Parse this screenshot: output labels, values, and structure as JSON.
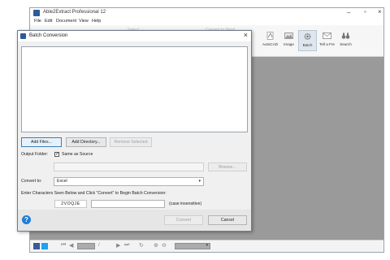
{
  "app": {
    "title": "Able2Extract Professional 12",
    "menu": [
      "File",
      "Edit",
      "Document",
      "View",
      "Help"
    ],
    "ribbon": {
      "ghost_labels": [
        "Select",
        "Convert to Word"
      ],
      "buttons": [
        {
          "label": "AutoCAD",
          "icon": "autocad-icon"
        },
        {
          "label": "Image",
          "icon": "image-icon"
        },
        {
          "label": "Batch",
          "icon": "batch-gear-icon"
        },
        {
          "label": "Tell a Fre",
          "icon": "envelope-icon"
        },
        {
          "label": "Search",
          "icon": "binoculars-icon"
        }
      ],
      "partial_label": "L"
    },
    "statusbar": {
      "page_separator": "/",
      "icons": [
        "facebook-icon",
        "twitter-icon",
        "first-page-icon",
        "prev-page-icon",
        "next-page-icon",
        "last-page-icon",
        "rotate-icon",
        "zoom-in-icon",
        "zoom-out-icon"
      ]
    }
  },
  "dialog": {
    "title": "Batch Conversion",
    "buttons": {
      "add_files": "Add Files...",
      "add_directory": "Add Directory...",
      "remove_selected": "Remove Selected",
      "browse": "Browse...",
      "convert": "Convert",
      "cancel": "Cancel"
    },
    "output_folder_label": "Output Folder:",
    "same_as_source_label": "Same as Source",
    "same_as_source_checked": true,
    "output_path_value": "",
    "convert_to_label": "Convert to:",
    "convert_to_value": "Excel",
    "captcha_instruction": "Enter Characters Seen Below and Click \"Convert\" to Begin Batch Conversion:",
    "captcha_code": "2VOQJE",
    "captcha_input_value": "",
    "case_note": "(case insensitive)",
    "help_glyph": "?"
  },
  "colors": {
    "accent": "#2b5a9e",
    "workspace": "#9a9a9a",
    "help": "#1f7ed6"
  }
}
